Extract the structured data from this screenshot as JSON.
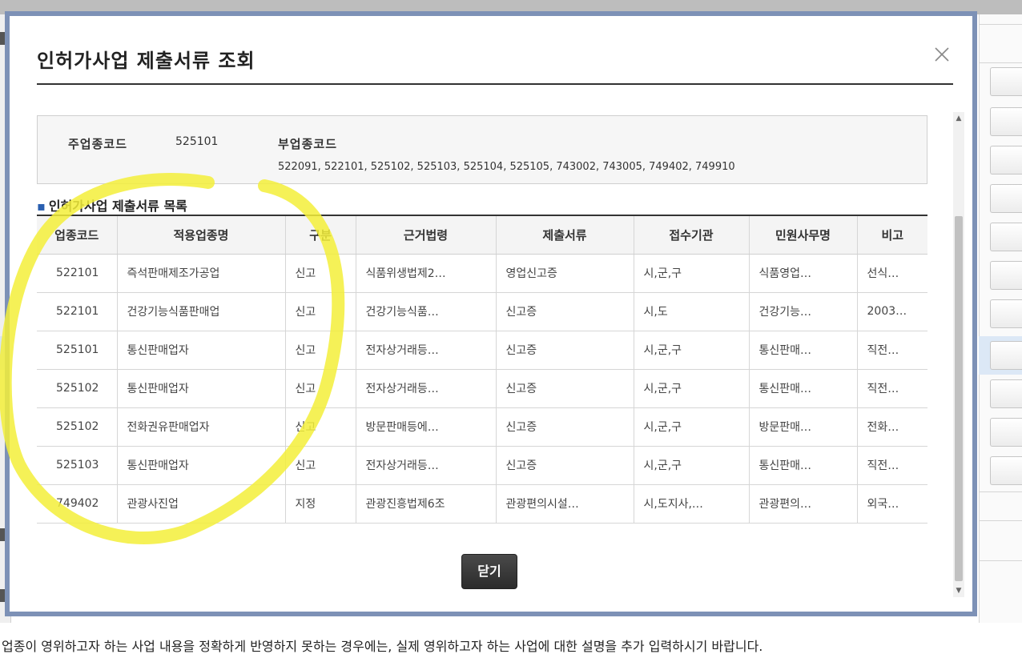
{
  "dialog": {
    "title": "인허가사업 제출서류 조회",
    "close_button_label": "닫기"
  },
  "info": {
    "main_code_label": "주업종코드",
    "main_code_value": "525101",
    "sub_code_label": "부업종코드",
    "sub_code_value": "522091, 522101, 525102, 525103, 525104, 525105, 743002, 743005, 749402, 749910"
  },
  "section": {
    "bullet": "▪",
    "title": "인허가사업 제출서류 목록"
  },
  "table": {
    "headers": [
      "업종코드",
      "적용업종명",
      "구분",
      "근거법령",
      "제출서류",
      "접수기관",
      "민원사무명",
      "비고"
    ],
    "rows": [
      [
        "522101",
        "즉석판매제조가공업",
        "신고",
        "식품위생법제2…",
        "영업신고증",
        "시,군,구",
        "식품영업…",
        "선식…"
      ],
      [
        "522101",
        "건강기능식품판매업",
        "신고",
        "건강기능식품…",
        "신고증",
        "시,도",
        "건강기능…",
        "2003…"
      ],
      [
        "525101",
        "통신판매업자",
        "신고",
        "전자상거래등…",
        "신고증",
        "시,군,구",
        "통신판매…",
        "직전…"
      ],
      [
        "525102",
        "통신판매업자",
        "신고",
        "전자상거래등…",
        "신고증",
        "시,군,구",
        "통신판매…",
        "직전…"
      ],
      [
        "525102",
        "전화권유판매업자",
        "신고",
        "방문판매등에…",
        "신고증",
        "시,군,구",
        "방문판매…",
        "전화…"
      ],
      [
        "525103",
        "통신판매업자",
        "신고",
        "전자상거래등…",
        "신고증",
        "시,군,구",
        "통신판매…",
        "직전…"
      ],
      [
        "749402",
        "관광사진업",
        "지정",
        "관광진흥법제6조",
        "관광편의시설…",
        "시,도지사,…",
        "관광편의…",
        "외국…"
      ]
    ]
  },
  "background": {
    "footer_text": "업종이 영위하고자 하는 사업 내용을 정확하게 반영하지 못하는 경우에는, 실제 영위하고자 하는 사업에 대한 설명을 추가 입력하시기 바랍니다."
  },
  "colors": {
    "frame_border": "#7d91b6",
    "highlight": "#f3ef3a",
    "button_bg": "#333333"
  }
}
